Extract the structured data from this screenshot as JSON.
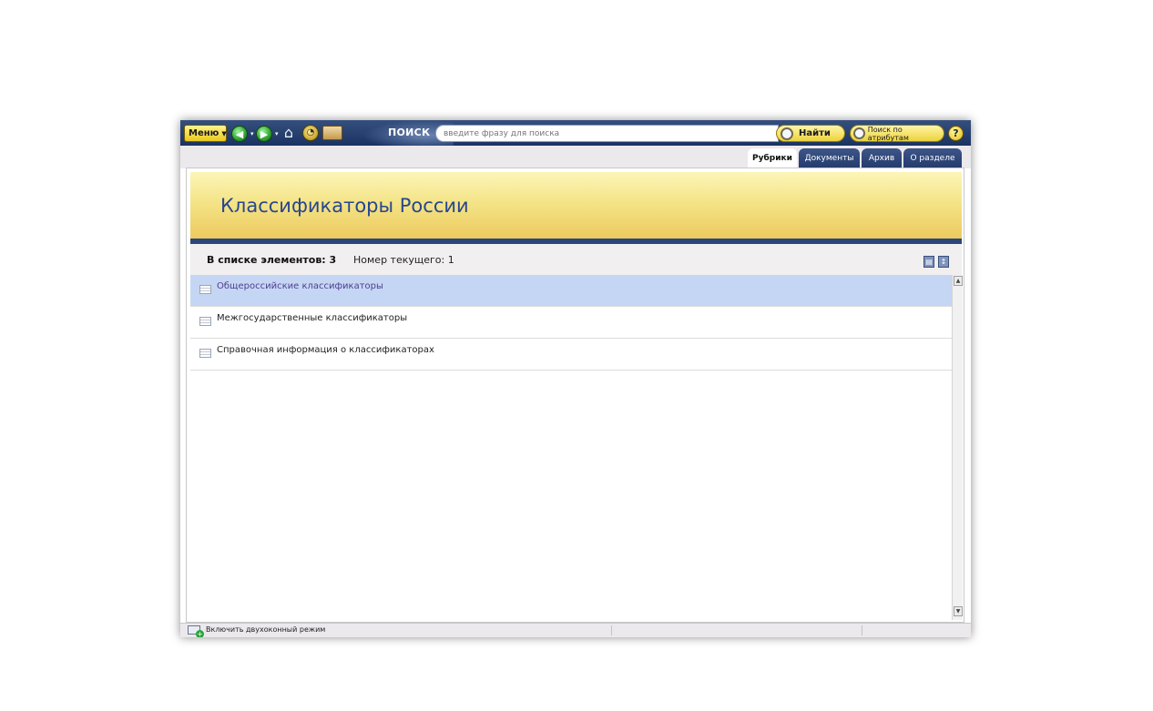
{
  "toolbar": {
    "menu_label": "Меню",
    "search_label": "ПОИСК",
    "search_placeholder": "введите фразу для поиска",
    "find_label": "Найти",
    "attr_search_label": "Поиск по атрибутам",
    "icons": [
      "back-icon",
      "forward-icon",
      "home-icon",
      "history-icon",
      "folder-icon",
      "help-icon"
    ]
  },
  "tabs": [
    {
      "label": "Рубрики",
      "active": true
    },
    {
      "label": "Документы",
      "active": false
    },
    {
      "label": "Архив",
      "active": false
    },
    {
      "label": "О разделе",
      "active": false
    }
  ],
  "banner": {
    "title": "Классификаторы России"
  },
  "info": {
    "count_label": "В списке элементов: 3",
    "current_label": "Номер текущего: 1"
  },
  "list": {
    "items": [
      {
        "label": "Общероссийские классификаторы",
        "selected": true
      },
      {
        "label": "Межгосударственные классификаторы",
        "selected": false
      },
      {
        "label": "Справочная информация о классификаторах",
        "selected": false
      }
    ]
  },
  "status": {
    "two_window_label": "Включить двухоконный режим"
  },
  "colors": {
    "toolbar": "#1f3868",
    "accent_yellow": "#ecd23b",
    "selected_row": "#c5d6f4",
    "banner_title": "#274690"
  }
}
